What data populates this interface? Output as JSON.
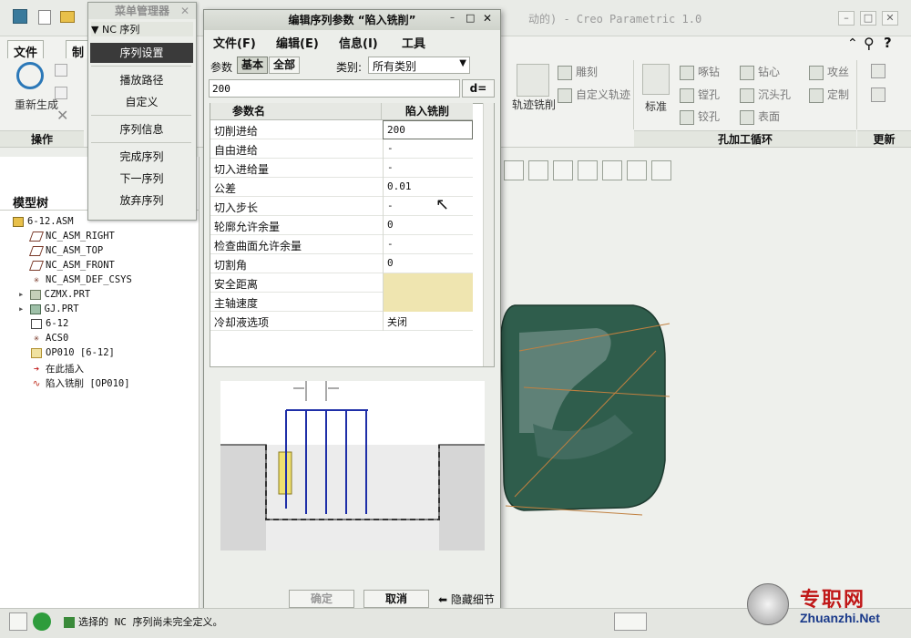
{
  "app": {
    "title": "动的) - Creo Parametric 1.0"
  },
  "ribbon": {
    "tabs": [
      "文件",
      "制"
    ],
    "regenerate_label": "重新生成",
    "operations_label": "操作",
    "groups": {
      "mill_trajectory": "轨迹铣削",
      "engrave": "雕刻",
      "custom_trajectory": "自定义轨迹",
      "standard": "标准",
      "spot_drill": "啄钻",
      "countersink_bore": "镗孔",
      "ream": "铰孔",
      "drill_center": "钻心",
      "counterbore": "沉头孔",
      "surface": "表面",
      "tap": "攻丝",
      "custom": "定制",
      "hole_cycle_title": "孔加工循环",
      "update_title": "更新"
    }
  },
  "model_tree": {
    "title": "模型树",
    "nodes": [
      {
        "label": "6-12.ASM",
        "icon": "assembly-icon"
      },
      {
        "label": "NC_ASM_RIGHT",
        "icon": "datum-plane-icon"
      },
      {
        "label": "NC_ASM_TOP",
        "icon": "datum-plane-icon"
      },
      {
        "label": "NC_ASM_FRONT",
        "icon": "datum-plane-icon"
      },
      {
        "label": "NC_ASM_DEF_CSYS",
        "icon": "csys-icon"
      },
      {
        "label": "CZMX.PRT",
        "icon": "part-icon"
      },
      {
        "label": "GJ.PRT",
        "icon": "part-icon"
      },
      {
        "label": "6-12",
        "icon": "workcell-icon"
      },
      {
        "label": "ACS0",
        "icon": "csys-icon"
      },
      {
        "label": "OP010 [6-12]",
        "icon": "operation-icon"
      },
      {
        "label": "在此插入",
        "icon": "insert-here-icon"
      },
      {
        "label": "陷入铣削 [OP010]",
        "icon": "plunge-mill-icon"
      }
    ]
  },
  "menu_manager": {
    "title": "菜单管理器",
    "section": "NC 序列",
    "items": [
      "序列设置",
      "播放路径",
      "自定义",
      "序列信息",
      "完成序列",
      "下一序列",
      "放弃序列"
    ]
  },
  "dialog": {
    "title": "编辑序列参数 “陷入铣削”",
    "menus": [
      "文件(F)",
      "编辑(E)",
      "信息(I)",
      "工具"
    ],
    "params_label": "参数",
    "basic_button": "基本",
    "all_button": "全部",
    "category_label": "类别:",
    "category_value": "所有类别",
    "value_input": "200",
    "d_equals": "d=",
    "columns": [
      "参数名",
      "陷入铣削"
    ],
    "rows": [
      {
        "name": "切削进给",
        "value": "200"
      },
      {
        "name": "自由进给",
        "value": "-"
      },
      {
        "name": "切入进给量",
        "value": "-"
      },
      {
        "name": "公差",
        "value": "0.01"
      },
      {
        "name": "切入步长",
        "value": "-"
      },
      {
        "name": "轮廓允许余量",
        "value": "0"
      },
      {
        "name": "检查曲面允许余量",
        "value": "-"
      },
      {
        "name": "切割角",
        "value": "0"
      },
      {
        "name": "安全距离",
        "value": ""
      },
      {
        "name": "主轴速度",
        "value": ""
      },
      {
        "name": "冷却液选项",
        "value": "关闭"
      }
    ],
    "ok_button": "确定",
    "cancel_button": "取消",
    "hide_details": "隐藏细节"
  },
  "status": {
    "message": "选择的 NC 序列尚未完全定义。"
  },
  "watermark": {
    "brand": "专职网",
    "url": "Zhuanzhi.Net"
  },
  "colors": {
    "part_green": "#2f5d4c",
    "highlight_cell": "#efe5b0",
    "selected_menu": "#3a3a3a",
    "tool_blue": "#1f2fa8"
  }
}
